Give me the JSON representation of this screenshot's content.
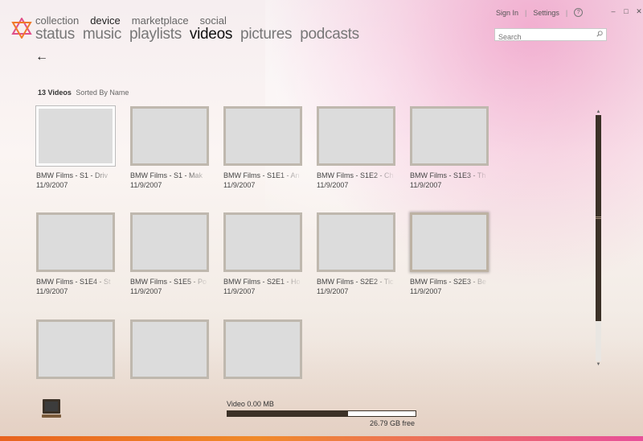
{
  "header": {
    "pivots": [
      {
        "label": "collection",
        "active": false
      },
      {
        "label": "device",
        "active": true
      },
      {
        "label": "marketplace",
        "active": false
      },
      {
        "label": "social",
        "active": false
      }
    ],
    "tabs": [
      {
        "label": "status",
        "active": false
      },
      {
        "label": "music",
        "active": false
      },
      {
        "label": "playlists",
        "active": false
      },
      {
        "label": "videos",
        "active": true
      },
      {
        "label": "pictures",
        "active": false
      },
      {
        "label": "podcasts",
        "active": false
      }
    ],
    "sign_in": "Sign In",
    "settings": "Settings",
    "separator": "|",
    "help": "?",
    "search_placeholder": "Search",
    "window_controls": {
      "minimize": "–",
      "maximize": "□",
      "close": "✕"
    }
  },
  "summary": {
    "count": "13 Videos",
    "sorted": "Sorted By Name"
  },
  "videos": [
    {
      "title": "BMW Films - S1 - Driv",
      "date": "11/9/2007",
      "state": "selected"
    },
    {
      "title": "BMW Films - S1 - Mak",
      "date": "11/9/2007",
      "state": "normal"
    },
    {
      "title": "BMW Films - S1E1 - An",
      "date": "11/9/2007",
      "state": "normal"
    },
    {
      "title": "BMW Films - S1E2 - Ch",
      "date": "11/9/2007",
      "state": "normal"
    },
    {
      "title": "BMW Films - S1E3 - Th",
      "date": "11/9/2007",
      "state": "normal"
    },
    {
      "title": "BMW Films - S1E4 - St",
      "date": "11/9/2007",
      "state": "normal"
    },
    {
      "title": "BMW Films - S1E5 - Po",
      "date": "11/9/2007",
      "state": "normal"
    },
    {
      "title": "BMW Films - S2E1 - Ho",
      "date": "11/9/2007",
      "state": "normal"
    },
    {
      "title": "BMW Films - S2E2 - Tic",
      "date": "11/9/2007",
      "state": "normal"
    },
    {
      "title": "BMW Films - S2E3 - Be",
      "date": "11/9/2007",
      "state": "hovered"
    },
    {
      "title": "",
      "date": "",
      "state": "normal"
    },
    {
      "title": "",
      "date": "",
      "state": "normal"
    },
    {
      "title": "",
      "date": "",
      "state": "normal"
    }
  ],
  "footer": {
    "capacity_label": "Video 0.00 MB",
    "free_label": "26.79 GB free",
    "used_fraction": 0.64
  },
  "colors": {
    "accent_dark": "#3b3127",
    "stripe_orange": "#e8631f",
    "stripe_pink": "#e84f9a"
  }
}
